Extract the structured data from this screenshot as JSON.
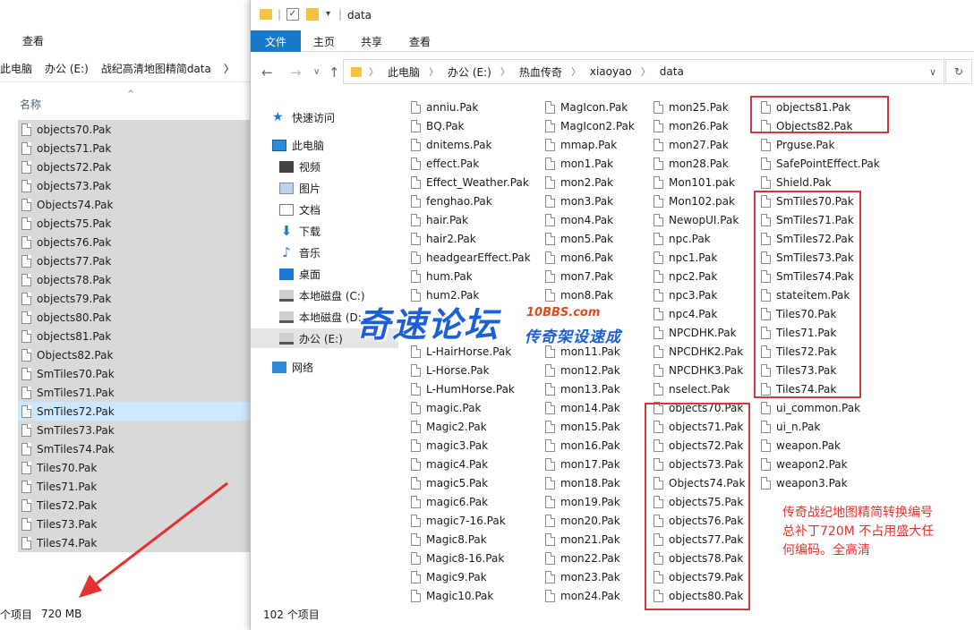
{
  "back_window": {
    "ribbon_tab": "查看",
    "address": [
      "此电脑",
      "办公 (E:)",
      "战纪高清地图精简data",
      "〉"
    ],
    "column_header": "名称",
    "files": [
      "objects70.Pak",
      "objects71.Pak",
      "objects72.Pak",
      "objects73.Pak",
      "Objects74.Pak",
      "objects75.Pak",
      "objects76.Pak",
      "objects77.Pak",
      "objects78.Pak",
      "objects79.Pak",
      "objects80.Pak",
      "objects81.Pak",
      "Objects82.Pak",
      "SmTiles70.Pak",
      "SmTiles71.Pak",
      "SmTiles72.Pak",
      "SmTiles73.Pak",
      "SmTiles74.Pak",
      "Tiles70.Pak",
      "Tiles71.Pak",
      "Tiles72.Pak",
      "Tiles73.Pak",
      "Tiles74.Pak"
    ],
    "selected_file": "SmTiles72.Pak",
    "status_items": "个项目",
    "status_size": "720 MB"
  },
  "front_window": {
    "title": "data",
    "ribbon_tabs": {
      "file": "文件",
      "home": "主页",
      "share": "共享",
      "view": "查看"
    },
    "address": [
      "此电脑",
      "办公 (E:)",
      "热血传奇",
      "xiaoyao",
      "data"
    ],
    "nav": {
      "quick_access": "快速访问",
      "this_pc": "此电脑",
      "videos": "视频",
      "pictures": "图片",
      "documents": "文档",
      "downloads": "下载",
      "music": "音乐",
      "desktop": "桌面",
      "disk_c": "本地磁盘 (C:)",
      "disk_d": "本地磁盘 (D:",
      "disk_e": "办公 (E:)",
      "network": "网络"
    },
    "columns": [
      [
        "anniu.Pak",
        "BQ.Pak",
        "dnitems.Pak",
        "effect.Pak",
        "Effect_Weather.Pak",
        "fenghao.Pak",
        "hair.Pak",
        "hair2.Pak",
        "headgearEffect.Pak",
        "hum.Pak",
        "hum2.Pak",
        "",
        "",
        "L-HairHorse.Pak",
        "L-Horse.Pak",
        "L-HumHorse.Pak",
        "magic.Pak",
        "Magic2.Pak",
        "magic3.Pak",
        "magic4.Pak",
        "magic5.Pak",
        "magic6.Pak",
        "magic7-16.Pak",
        "Magic8.Pak",
        "Magic8-16.Pak",
        "Magic9.Pak",
        "Magic10.Pak"
      ],
      [
        "MagIcon.Pak",
        "MagIcon2.Pak",
        "mmap.Pak",
        "mon1.Pak",
        "mon2.Pak",
        "mon3.Pak",
        "mon4.Pak",
        "mon5.Pak",
        "mon6.Pak",
        "mon7.Pak",
        "mon8.Pak",
        "",
        "",
        "mon11.Pak",
        "mon12.Pak",
        "mon13.Pak",
        "mon14.Pak",
        "mon15.Pak",
        "mon16.Pak",
        "mon17.Pak",
        "mon18.Pak",
        "mon19.Pak",
        "mon20.Pak",
        "mon21.Pak",
        "mon22.Pak",
        "mon23.Pak",
        "mon24.Pak"
      ],
      [
        "mon25.Pak",
        "mon26.Pak",
        "mon27.Pak",
        "mon28.Pak",
        "Mon101.pak",
        "Mon102.pak",
        "NewopUI.Pak",
        "npc.Pak",
        "npc1.Pak",
        "npc2.Pak",
        "npc3.Pak",
        "npc4.Pak",
        "NPCDHK.Pak",
        "NPCDHK2.Pak",
        "NPCDHK3.Pak",
        "nselect.Pak",
        "objects70.Pak",
        "objects71.Pak",
        "objects72.Pak",
        "objects73.Pak",
        "Objects74.Pak",
        "objects75.Pak",
        "objects76.Pak",
        "objects77.Pak",
        "objects78.Pak",
        "objects79.Pak",
        "objects80.Pak"
      ],
      [
        "objects81.Pak",
        "Objects82.Pak",
        "Prguse.Pak",
        "SafePointEffect.Pak",
        "Shield.Pak",
        "SmTiles70.Pak",
        "SmTiles71.Pak",
        "SmTiles72.Pak",
        "SmTiles73.Pak",
        "SmTiles74.Pak",
        "stateitem.Pak",
        "Tiles70.Pak",
        "Tiles71.Pak",
        "Tiles72.Pak",
        "Tiles73.Pak",
        "Tiles74.Pak",
        "ui_common.Pak",
        "ui_n.Pak",
        "weapon.Pak",
        "weapon2.Pak",
        "weapon3.Pak"
      ]
    ],
    "status": "102 个项目"
  },
  "annotation": {
    "lines": [
      "传奇战纪地图精简转换编号",
      "总补丁720M  不占用盛大任",
      "何编码。全高清"
    ],
    "color": "#e3322f"
  },
  "watermark": {
    "main": "奇速论坛",
    "url": "10BBS.com",
    "sub": "传奇架设速成"
  },
  "colors": {
    "highlight_box": "#d13a3a",
    "selection": "#cce8ff",
    "ribbon_file": "#1979ca"
  }
}
